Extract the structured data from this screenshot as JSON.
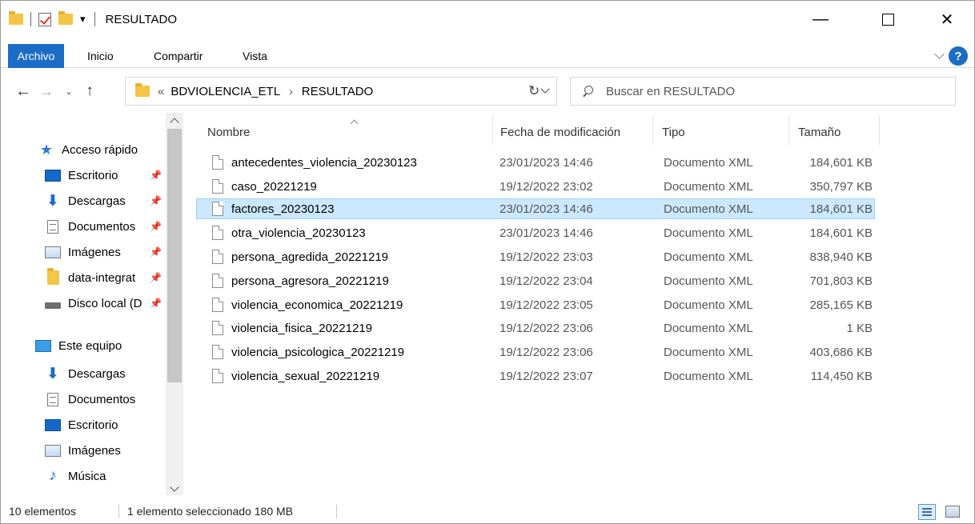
{
  "window": {
    "title": "RESULTADO",
    "qa_dropdown": "▾",
    "minimize_glyph": "—",
    "close_glyph": "✕"
  },
  "ribbon": {
    "tabs": [
      "Archivo",
      "Inicio",
      "Compartir",
      "Vista"
    ],
    "help_glyph": "?"
  },
  "nav": {
    "back_glyph": "←",
    "forward_glyph": "→",
    "recent_glyph": "⌄",
    "up_glyph": "↑",
    "breadcrumb_overflow": "«",
    "breadcrumb": [
      "BDVIOLENCIA_ETL",
      "RESULTADO"
    ],
    "breadcrumb_arrow": "›",
    "refresh_glyph": "↻",
    "search_placeholder": "Buscar en RESULTADO"
  },
  "sidebar": {
    "items": [
      {
        "label": "Acceso rápido",
        "icon": "star-icon"
      },
      {
        "label": "Escritorio",
        "icon": "desktop-icon",
        "pinned": true
      },
      {
        "label": "Descargas",
        "icon": "download-icon",
        "pinned": true
      },
      {
        "label": "Documentos",
        "icon": "documents-icon",
        "pinned": true
      },
      {
        "label": "Imágenes",
        "icon": "pictures-icon",
        "pinned": true
      },
      {
        "label": "data-integrat",
        "icon": "folder-icon",
        "pinned": true
      },
      {
        "label": "Disco local (D",
        "icon": "drive-icon",
        "pinned": true
      },
      {
        "label": "Este equipo",
        "icon": "computer-icon"
      },
      {
        "label": "Descargas",
        "icon": "download-icon"
      },
      {
        "label": "Documentos",
        "icon": "documents-icon"
      },
      {
        "label": "Escritorio",
        "icon": "desktop-icon"
      },
      {
        "label": "Imágenes",
        "icon": "pictures-icon"
      },
      {
        "label": "Música",
        "icon": "music-icon"
      }
    ],
    "pin_glyph": "📌"
  },
  "columns": {
    "name": "Nombre",
    "date": "Fecha de modificación",
    "type": "Tipo",
    "size": "Tamaño"
  },
  "files": [
    {
      "name": "antecedentes_violencia_20230123",
      "date": "23/01/2023 14:46",
      "type": "Documento XML",
      "size": "184,601 KB"
    },
    {
      "name": "caso_20221219",
      "date": "19/12/2022 23:02",
      "type": "Documento XML",
      "size": "350,797 KB"
    },
    {
      "name": "factores_20230123",
      "date": "23/01/2023 14:46",
      "type": "Documento XML",
      "size": "184,601 KB",
      "selected": true
    },
    {
      "name": "otra_violencia_20230123",
      "date": "23/01/2023 14:46",
      "type": "Documento XML",
      "size": "184,601 KB"
    },
    {
      "name": "persona_agredida_20221219",
      "date": "19/12/2022 23:03",
      "type": "Documento XML",
      "size": "838,940 KB"
    },
    {
      "name": "persona_agresora_20221219",
      "date": "19/12/2022 23:04",
      "type": "Documento XML",
      "size": "701,803 KB"
    },
    {
      "name": "violencia_economica_20221219",
      "date": "19/12/2022 23:05",
      "type": "Documento XML",
      "size": "285,165 KB"
    },
    {
      "name": "violencia_fisica_20221219",
      "date": "19/12/2022 23:06",
      "type": "Documento XML",
      "size": "1 KB"
    },
    {
      "name": "violencia_psicologica_20221219",
      "date": "19/12/2022 23:06",
      "type": "Documento XML",
      "size": "403,686 KB"
    },
    {
      "name": "violencia_sexual_20221219",
      "date": "19/12/2022 23:07",
      "type": "Documento XML",
      "size": "114,450 KB"
    }
  ],
  "status": {
    "count": "10 elementos",
    "selection": "1 elemento seleccionado 180 MB"
  },
  "colors": {
    "accent": "#1a6cc5",
    "selection_bg": "#cce8ff",
    "selection_border": "#99d1ff",
    "folder": "#f3c645"
  }
}
